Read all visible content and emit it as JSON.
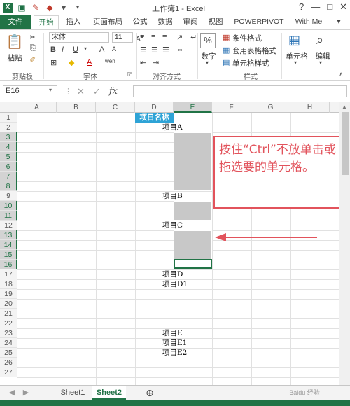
{
  "window": {
    "title": "工作簿1 - Excel",
    "controls": [
      "?",
      "—",
      "□",
      "✕"
    ]
  },
  "ribbon_tabs": [
    "文件",
    "开始",
    "插入",
    "页面布局",
    "公式",
    "数据",
    "审阅",
    "视图",
    "POWERPIVOT",
    "With Me"
  ],
  "ribbon": {
    "clipboard": {
      "paste": "粘贴",
      "group": "剪贴板"
    },
    "font": {
      "name": "宋体",
      "size": "11",
      "bold": "B",
      "italic": "I",
      "underline": "U",
      "grow": "A",
      "shrink": "A",
      "font_color": "A",
      "wen": "wén",
      "group": "字体"
    },
    "alignment": {
      "group": "对齐方式"
    },
    "number": {
      "label": "数字",
      "percent": "%"
    },
    "styles": {
      "conditional": "条件格式",
      "table": "套用表格格式",
      "cell": "单元格样式",
      "group": "样式"
    },
    "cells": {
      "label": "单元格"
    },
    "editing": {
      "label": "编辑"
    }
  },
  "formula_bar": {
    "name_box": "E16",
    "fx": "fx",
    "value": ""
  },
  "columns": [
    "A",
    "B",
    "C",
    "D",
    "E",
    "F",
    "G",
    "H"
  ],
  "rows": [
    "1",
    "2",
    "3",
    "4",
    "5",
    "6",
    "7",
    "8",
    "9",
    "10",
    "11",
    "12",
    "13",
    "14",
    "15",
    "16",
    "17",
    "18",
    "19",
    "20",
    "21",
    "22",
    "23",
    "24",
    "25",
    "26",
    "27"
  ],
  "cells": {
    "header": "项目名称",
    "r2": "项目A",
    "r9": "项目B",
    "r12": "项目C",
    "r17": "项目D",
    "r18": "项目D1",
    "r23": "项目E",
    "r24": "项目E1",
    "r25": "项目E2"
  },
  "annotation": "按住“Ctrl”不放单击或拖选要的单元格。",
  "sheets": [
    "Sheet1",
    "Sheet2"
  ],
  "active_sheet": "Sheet2",
  "watermark": "Baidu 经验 jingyan.baidu.com",
  "colors": {
    "excel_green": "#217346",
    "header_blue": "#2ea3d6",
    "annotation_red": "#e2535c",
    "selection_gray": "#c8c8c8"
  }
}
